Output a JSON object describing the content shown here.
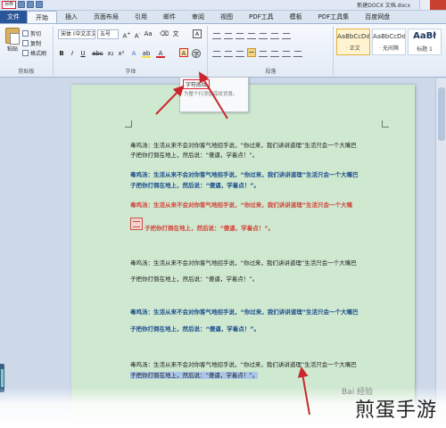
{
  "window": {
    "title": "新建DOCX 文档.docx"
  },
  "quick_access": {
    "selected_label": "另存"
  },
  "tabs": [
    {
      "label": "文件"
    },
    {
      "label": "开始"
    },
    {
      "label": "插入"
    },
    {
      "label": "页面布局"
    },
    {
      "label": "引用"
    },
    {
      "label": "邮件"
    },
    {
      "label": "审阅"
    },
    {
      "label": "视图"
    },
    {
      "label": "PDF工具"
    },
    {
      "label": "模板"
    },
    {
      "label": "PDF工具集"
    },
    {
      "label": "百度网盘"
    }
  ],
  "ribbon": {
    "clipboard": {
      "paste_label": "粘贴",
      "cut_label": "剪切",
      "copy_label": "复制",
      "format_painter_label": "格式刷",
      "group_label": "剪贴板"
    },
    "font": {
      "font_name": "宋体 (中文正文)",
      "font_size": "五号",
      "group_label": "字体"
    },
    "paragraph": {
      "group_label": "段落"
    },
    "styles": [
      {
        "sample": "AaBbCcDd",
        "name": "· 正文"
      },
      {
        "sample": "AaBbCcDd",
        "name": "· 无间隔"
      },
      {
        "sample": "AaBł",
        "name": "标题 1"
      }
    ]
  },
  "tooltip": {
    "title": "字符底纹",
    "body": "为整个行添加底纹背景。"
  },
  "document": {
    "p1_line1": "毒鸡汤：生活从来不会对你客气地招手说，“你过来，我们讲讲道理”生活只会一个大嘴巴",
    "p1_line2": "子把你打倒在地上，然后说：“傻逼，学着点！”。",
    "p2_line1": "毒鸡汤：生活从来不会对你客气地招手说，“你过来，我们讲讲道理”生活只会一个大嘴巴",
    "p2_line2": "子把你打倒在地上，然后说：“傻逼，学着点！”。",
    "p3_line1": "毒鸡汤：生活从来不会对你客气地招手说，“你过来，我们讲讲道理”生活只会一个大嘴",
    "p3_line2": "子把你打倒在地上，然后说：“傻逼，学着点！”。",
    "p4_line1": "毒鸡汤：生活从来不会对你客气地招手说，“你过来，我们讲讲道理”生活只会一个大嘴巴",
    "p4_line2": "子把你打倒在地上，然后说：“傻逼，学着点！”。",
    "p5_line1": "毒鸡汤：生活从来不会对你客气地招手说，“你过来，我们讲讲道理”生活只会一个大嘴巴",
    "p5_line2": "子把你打倒在地上，然后说：“傻逼，学着点！”。",
    "p6_line1": "毒鸡汤：生活从来不会对你客气地招手说，“你过来，我们讲讲道理”生活只会一个大嘴巴",
    "p6_line2": "子把你打倒在地上，然后说：“傻逼，学着点！”。"
  },
  "watermark": {
    "text": "煎蛋手游",
    "small": "Bai 经验"
  },
  "colors": {
    "file_tab": "#2a5699",
    "page_bg": "#cfe8d0",
    "blue_text": "#1c4e8c",
    "red_text": "#d4433a",
    "arrow": "#c8282d",
    "selection": "#a9c6ea"
  }
}
